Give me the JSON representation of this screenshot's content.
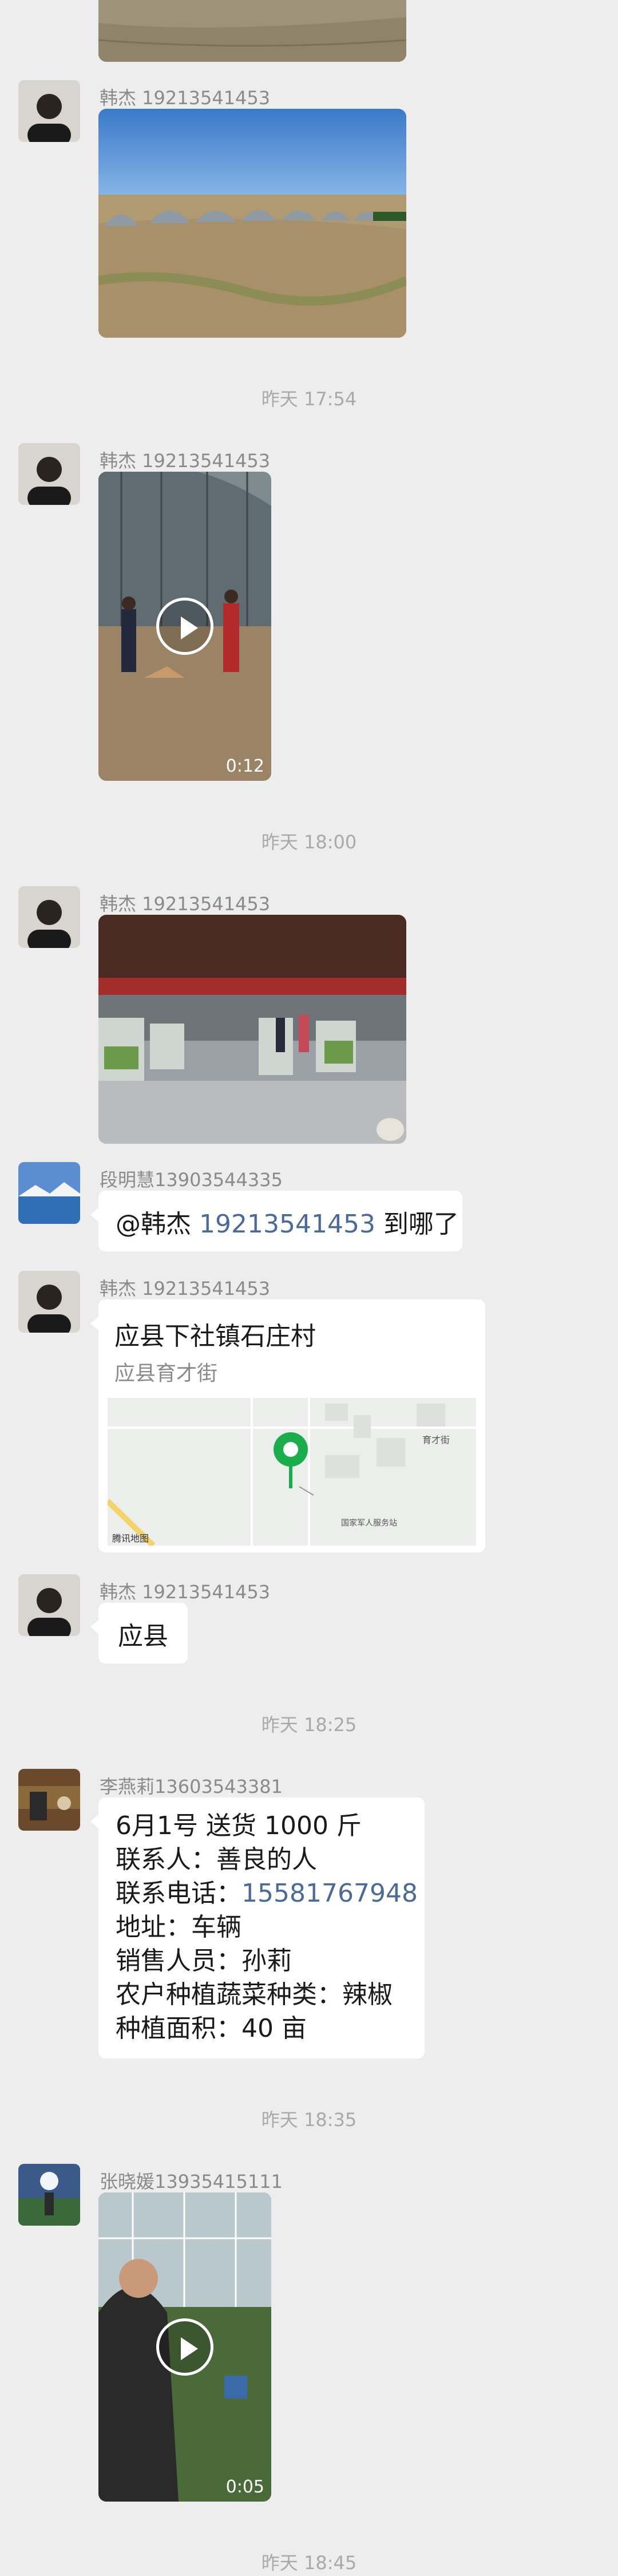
{
  "messages": {
    "m1": {
      "sender": "韩杰 19213541453"
    },
    "ts1": "昨天 17:54",
    "m2": {
      "sender": "韩杰 19213541453",
      "duration": "0:12"
    },
    "ts2": "昨天 18:00",
    "m3": {
      "sender": "韩杰 19213541453"
    },
    "m4": {
      "sender": "段明慧13903544335",
      "mention": "@韩杰",
      "phone": "19213541453",
      "rest": "到哪了"
    },
    "m5": {
      "sender": "韩杰 19213541453",
      "title": "应县下社镇石庄村",
      "address": "应县育才街",
      "map_brand": "腾讯地图",
      "map_label": "育才街",
      "map_poi": "国家军人服务站"
    },
    "m6": {
      "sender": "韩杰 19213541453",
      "text": "应县"
    },
    "ts3": "昨天 18:25",
    "m7": {
      "sender": "李燕莉13603543381",
      "line1": "6月1号  送货   1000 斤",
      "line2": "联系人：善良的人",
      "line3_prefix": "联系电话：",
      "line3_phone": "15581767948",
      "line4": "地址：车辆",
      "line5": "销售人员：孙莉",
      "line6": "农户种植蔬菜种类：辣椒",
      "line7": "种植面积：40 亩"
    },
    "ts4": "昨天 18:35",
    "m8": {
      "sender": "张晓媛13935415111",
      "duration": "0:05"
    },
    "ts5": "昨天 18:45"
  },
  "colors": {
    "background": "#ededed",
    "bubble": "#ffffff",
    "link": "#4a6a9c",
    "map_pin": "#1aad4c"
  }
}
